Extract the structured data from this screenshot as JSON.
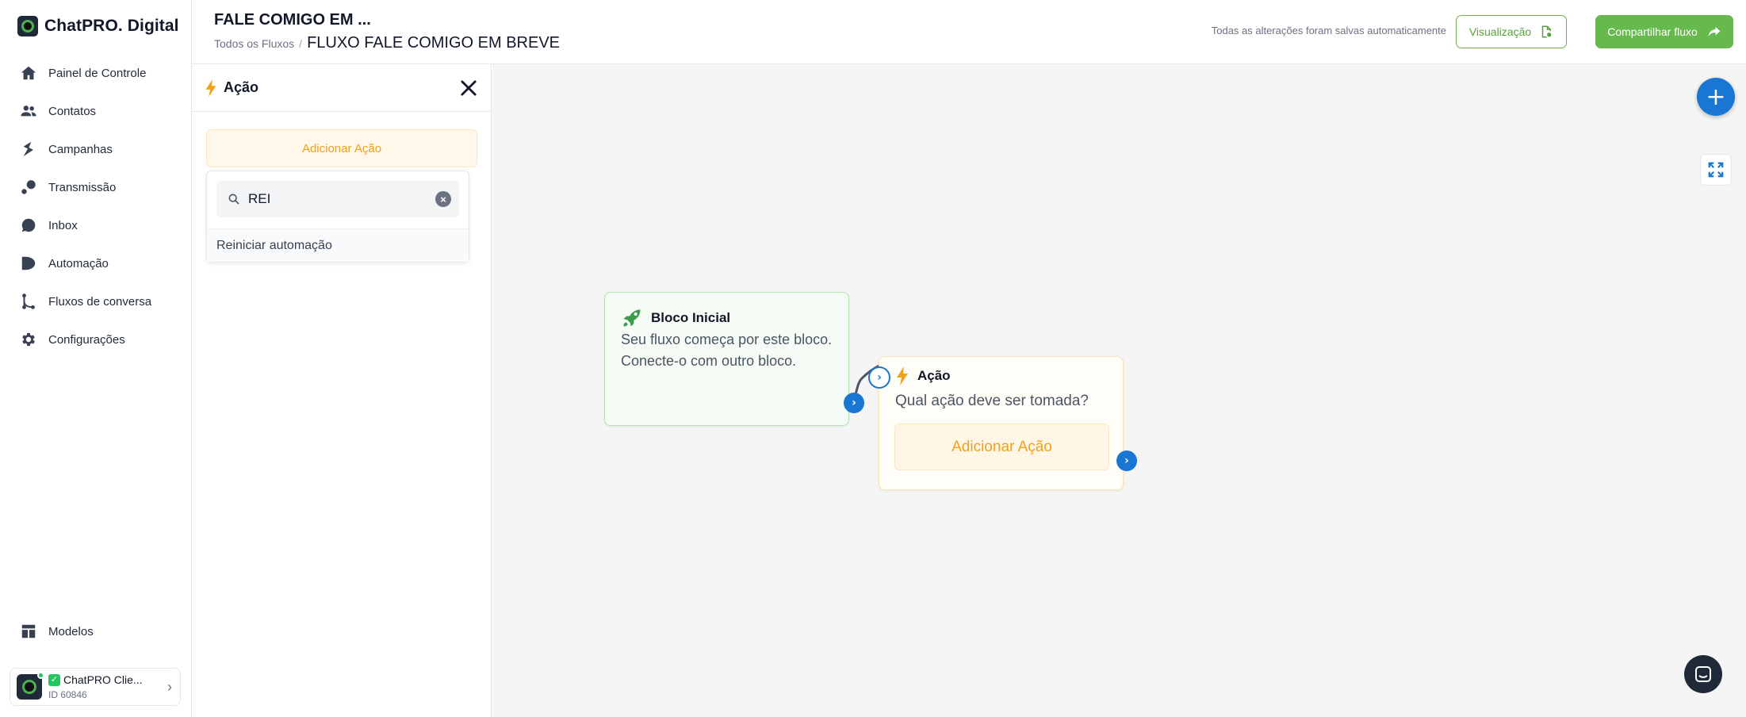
{
  "brand": {
    "name": "ChatPRO. Digital"
  },
  "sidebar": {
    "items": [
      {
        "label": "Painel de Controle",
        "icon": "home-icon"
      },
      {
        "label": "Contatos",
        "icon": "contacts-icon"
      },
      {
        "label": "Campanhas",
        "icon": "campaign-icon"
      },
      {
        "label": "Transmissão",
        "icon": "broadcast-icon"
      },
      {
        "label": "Inbox",
        "icon": "chat-bubble-icon"
      },
      {
        "label": "Automação",
        "icon": "automation-icon"
      },
      {
        "label": "Fluxos de conversa",
        "icon": "flow-icon"
      },
      {
        "label": "Configurações",
        "icon": "gear-icon"
      }
    ],
    "bottom": {
      "label": "Modelos",
      "icon": "templates-icon"
    },
    "account": {
      "name": "ChatPRO Clie...",
      "id": "ID 60846",
      "status_color": "#22c55e"
    }
  },
  "header": {
    "title": "FALE COMIGO EM ...",
    "breadcrumb_link": "Todos os Fluxos",
    "breadcrumb_sep": "/",
    "breadcrumb_current": "FLUXO FALE COMIGO EM BREVE",
    "autosave": "Todas as alterações foram salvas automaticamente",
    "preview_label": "Visualização",
    "share_label": "Compartilhar fluxo"
  },
  "panel": {
    "title": "Ação",
    "add_action_label": "Adicionar Ação",
    "search": {
      "value": "REI",
      "placeholder": ""
    },
    "results": [
      "Reiniciar automação"
    ]
  },
  "canvas": {
    "start_node": {
      "title": "Bloco Inicial",
      "body": "Seu fluxo começa por este bloco. Conecte-o com outro bloco."
    },
    "action_node": {
      "title": "Ação",
      "body": "Qual ação deve ser tomada?",
      "add_label": "Adicionar Ação"
    }
  },
  "colors": {
    "accent_blue": "#1976d2",
    "green": "#66b94c",
    "orange": "#f0a11a"
  }
}
